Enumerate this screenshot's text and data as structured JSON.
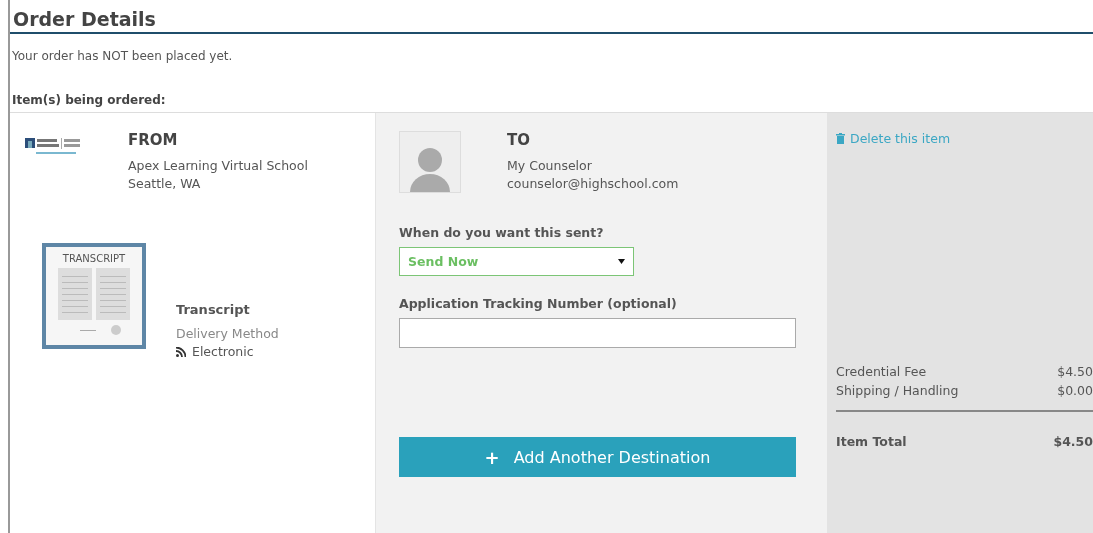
{
  "page": {
    "title": "Order Details",
    "notice": "Your order has NOT been placed yet.",
    "items_heading": "Item(s) being ordered:"
  },
  "from": {
    "heading": "FROM",
    "name": "Apex Learning Virtual School",
    "location": "Seattle, WA"
  },
  "document": {
    "thumbnail_label": "TRANSCRIPT",
    "name": "Transcript",
    "delivery_label": "Delivery Method",
    "delivery_method": "Electronic"
  },
  "to": {
    "heading": "TO",
    "name": "My Counselor",
    "email": "counselor@highschool.com"
  },
  "send_when": {
    "label": "When do you want this sent?",
    "value": "Send Now"
  },
  "tracking": {
    "label": "Application Tracking Number (optional)"
  },
  "add_button": {
    "icon": "+",
    "label": "Add Another Destination"
  },
  "delete_link": "Delete this item",
  "fees": [
    {
      "label": "Credential Fee",
      "amount": "$4.50"
    },
    {
      "label": "Shipping / Handling",
      "amount": "$0.00"
    }
  ],
  "total": {
    "label": "Item Total",
    "amount": "$4.50"
  }
}
